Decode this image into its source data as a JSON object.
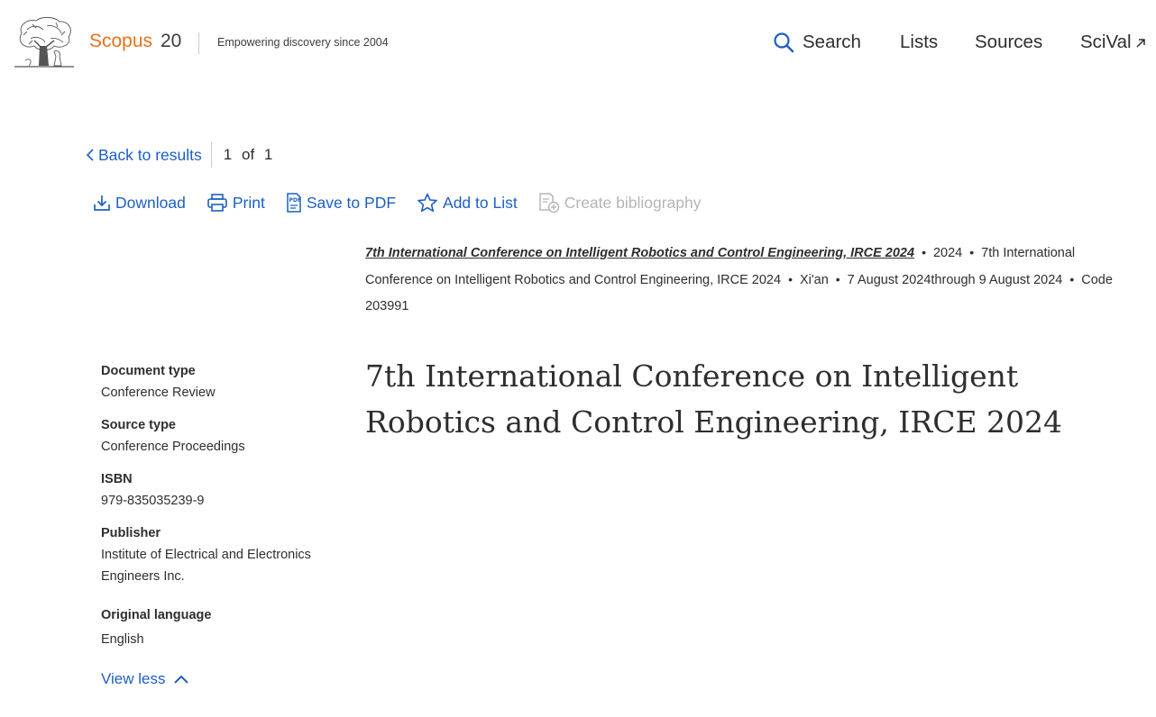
{
  "header": {
    "brand": "Scopus",
    "brand_number": "20",
    "tagline": "Empowering discovery since 2004",
    "nav": {
      "search": "Search",
      "lists": "Lists",
      "sources": "Sources",
      "scival": "SciVal"
    }
  },
  "navigation": {
    "back_label": "Back to results",
    "current": "1",
    "of_label": "of",
    "total": "1"
  },
  "toolbar": {
    "download": "Download",
    "print": "Print",
    "save_pdf": "Save to PDF",
    "add_list": "Add to List",
    "create_bibliography": "Create bibliography"
  },
  "source": {
    "title": "7th International Conference on Intelligent Robotics and Control Engineering, IRCE 2024",
    "year": "2024",
    "conference_name": "7th International Conference on Intelligent Robotics and Control Engineering, IRCE 2024",
    "location": "Xi'an",
    "dates": "7 August 2024through 9 August 2024",
    "code": "Code 203991"
  },
  "details": {
    "document_type_label": "Document type",
    "document_type": "Conference Review",
    "source_type_label": "Source type",
    "source_type": "Conference Proceedings",
    "isbn_label": "ISBN",
    "isbn": "979-835035239-9",
    "publisher_label": "Publisher",
    "publisher": "Institute of Electrical and Electronics Engineers Inc.",
    "language_label": "Original language",
    "language": "English",
    "view_less": "View less"
  },
  "document": {
    "title": "7th International Conference on Intelligent Robotics and Control Engineering, IRCE 2024"
  },
  "colors": {
    "brand": "#e9711c",
    "link": "#1d5fc4",
    "disabled": "#b5b5b5",
    "text": "#2e2e2e"
  }
}
